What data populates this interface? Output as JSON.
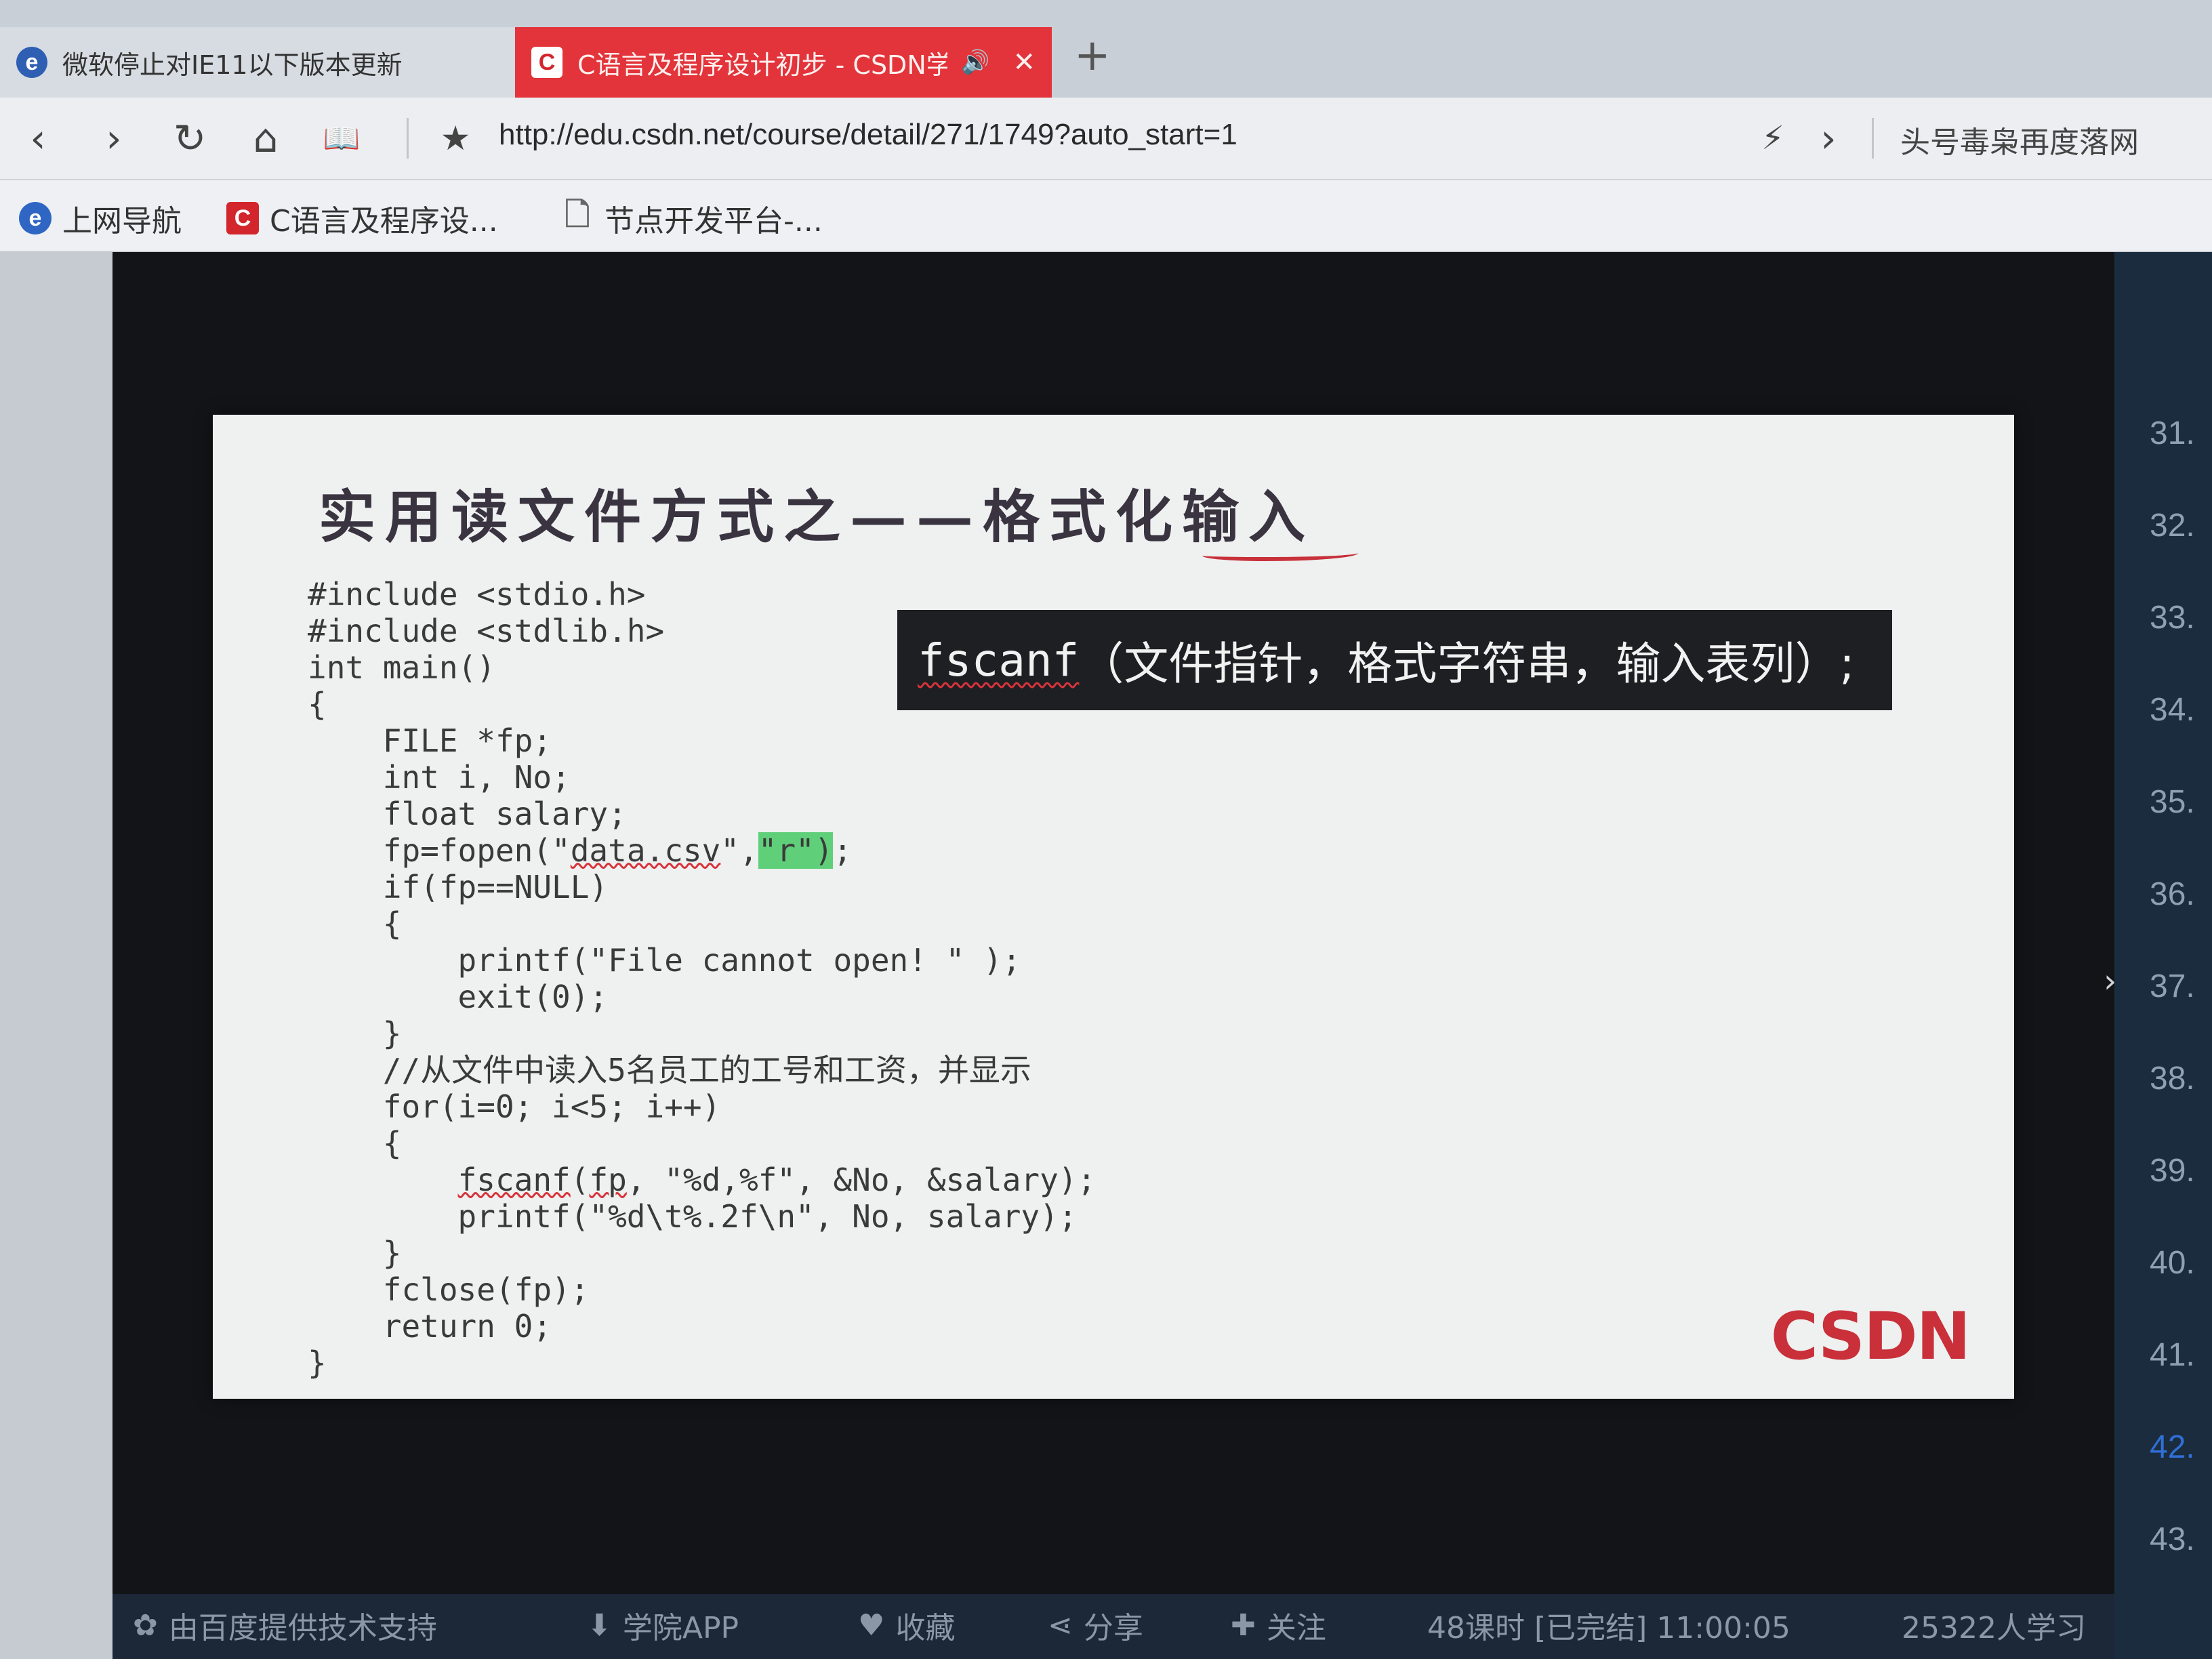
{
  "tabs": [
    {
      "title": "微软停止对IE11以下版本更新",
      "favicon": "ie-icon",
      "active": false
    },
    {
      "title": "C语言及程序设计初步 - CSDN学",
      "favicon": "csdn-c-icon",
      "active": true,
      "audio": "🔊",
      "close": "✕"
    }
  ],
  "new_tab": "+",
  "nav": {
    "back": "‹",
    "forward": "›",
    "refresh": "↻",
    "home": "⌂",
    "reading": "📖",
    "favorite": "★",
    "url": "http://edu.csdn.net/course/detail/271/1749?auto_start=1",
    "accelerate": "⚡",
    "more": "›",
    "news": "头号毒枭再度落网"
  },
  "favorites": [
    {
      "label": "上网导航",
      "icon": "ie-icon",
      "glyph": "e"
    },
    {
      "label": "C语言及程序设...",
      "icon": "csdn-c-icon",
      "glyph": "C"
    },
    {
      "label": "节点开发平台-...",
      "icon": "page-icon",
      "glyph": "🗋"
    }
  ],
  "slide": {
    "title": "实用读文件方式之——格式化输入",
    "callout_fn": "fscanf",
    "callout_args": "（文件指针，格式字符串，输入表列）;",
    "code": [
      "#include <stdio.h>",
      "#include <stdlib.h>",
      "int main()",
      "{",
      "    FILE *fp;",
      "    int i, No;",
      "    float salary;",
      {
        "pre": "    fp=fopen(\"",
        "file": "data.csv",
        "mid": "\",",
        "mode": "\"r\")",
        "post": ";"
      },
      "    if(fp==NULL)",
      "    {",
      "        printf(\"File cannot open! \" );",
      "        exit(0);",
      "    }",
      "    //从文件中读入5名员工的工号和工资，并显示",
      "    for(i=0; i<5; i++)",
      "    {",
      {
        "pre": "        ",
        "fn": "fscanf",
        "mid": "(",
        "arg": "fp",
        "post": ", \"%d,%f\", &No, &salary);"
      },
      "        printf(\"%d\\t%.2f\\n\", No, salary);",
      "    }",
      "    fclose(fp);",
      "    return 0;",
      "}"
    ],
    "logo": "CSDN"
  },
  "lessons": [
    "31.",
    "32.",
    "33.",
    "34.",
    "35.",
    "36.",
    "37.",
    "38.",
    "39.",
    "40.",
    "41.",
    "42.",
    "43."
  ],
  "active_lesson": "42.",
  "lesson_expand": "›",
  "bottom": {
    "provider": "由百度提供技术支持",
    "app": "学院APP",
    "collect": "收藏",
    "share": "分享",
    "follow": "关注",
    "summary": "48课时 [已完结] 11:00:05",
    "learners": "25322人学习"
  },
  "colors": {
    "tab_active": "#e2343a",
    "code_highlight": "#5fcf7a",
    "squiggle": "#d8333c",
    "logo": "#c9303a",
    "active_lesson": "#2f6fd6"
  }
}
